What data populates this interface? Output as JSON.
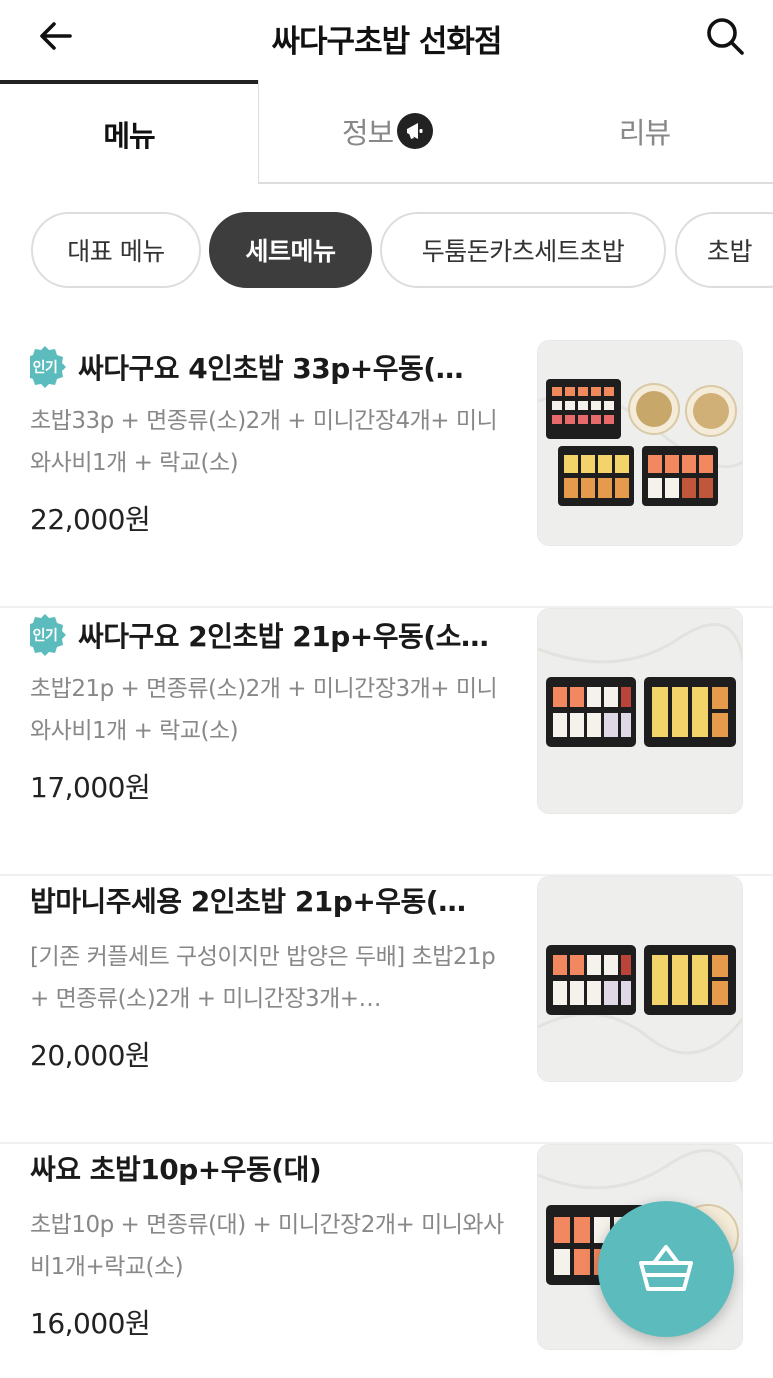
{
  "header": {
    "title": "싸다구초밥 선화점",
    "back_icon": "back-arrow-icon",
    "search_icon": "search-icon"
  },
  "tabs": [
    {
      "label": "메뉴",
      "active": true
    },
    {
      "label": "정보",
      "active": false,
      "icon": "megaphone-icon"
    },
    {
      "label": "리뷰",
      "active": false
    }
  ],
  "chips": [
    {
      "label": "대표 메뉴",
      "active": false
    },
    {
      "label": "세트메뉴",
      "active": true
    },
    {
      "label": "두툼돈카츠세트초밥",
      "active": false
    },
    {
      "label": "초밥",
      "active": false
    }
  ],
  "badge_label": "인기",
  "items": [
    {
      "name": "싸다구요 4인초밥 33p+우동(…",
      "popular": true,
      "desc": "초밥33p + 면종류(소)2개 + 미니간장4개+ 미니와사비1개 + 락교(소)",
      "price": "22,000원"
    },
    {
      "name": "싸다구요 2인초밥 21p+우동(소…",
      "popular": true,
      "desc": "초밥21p + 면종류(소)2개 + 미니간장3개+ 미니와사비1개 + 락교(소)",
      "price": "17,000원"
    },
    {
      "name": "밥마니주세용 2인초밥 21p+우동(…",
      "popular": false,
      "desc": "[기존 커플세트 구성이지만 밥양은 두배] 초밥21p + 면종류(소)2개 + 미니간장3개+…",
      "price": "20,000원"
    },
    {
      "name": "싸요 초밥10p+우동(대)",
      "popular": false,
      "desc": "초밥10p + 면종류(대) + 미니간장2개+ 미니와사비1개+락교(소)",
      "price": "16,000원"
    }
  ],
  "cart_icon": "shopping-basket-icon",
  "colors": {
    "accent": "#5cbcbd",
    "active_chip": "#3d3d3d",
    "muted_text": "#888888"
  }
}
